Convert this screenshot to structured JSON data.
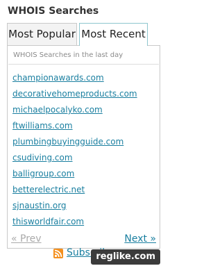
{
  "widget": {
    "title": "WHOIS Searches",
    "tabs": [
      {
        "label": "Most Popular",
        "active": false
      },
      {
        "label": "Most Recent",
        "active": true
      }
    ],
    "subtitle": "WHOIS Searches in the last day",
    "domains": [
      "championawards.com",
      "decorativehomeproducts.com",
      "michaelpocalyko.com",
      "ftwilliams.com",
      "plumbingbuyingguide.com",
      "csudiving.com",
      "balligroup.com",
      "betterelectric.net",
      "sjnaustin.org",
      "thisworldfair.com"
    ],
    "pagination": {
      "prev_label": "« Prev",
      "next_label": "Next »"
    },
    "subscribe_label": "Subscribe",
    "rss_icon": "rss-icon"
  },
  "watermark": "reglike.com",
  "colors": {
    "link": "#1a7fa0",
    "tab_active_border": "#8ec6ce",
    "rss": "#f4901e"
  }
}
